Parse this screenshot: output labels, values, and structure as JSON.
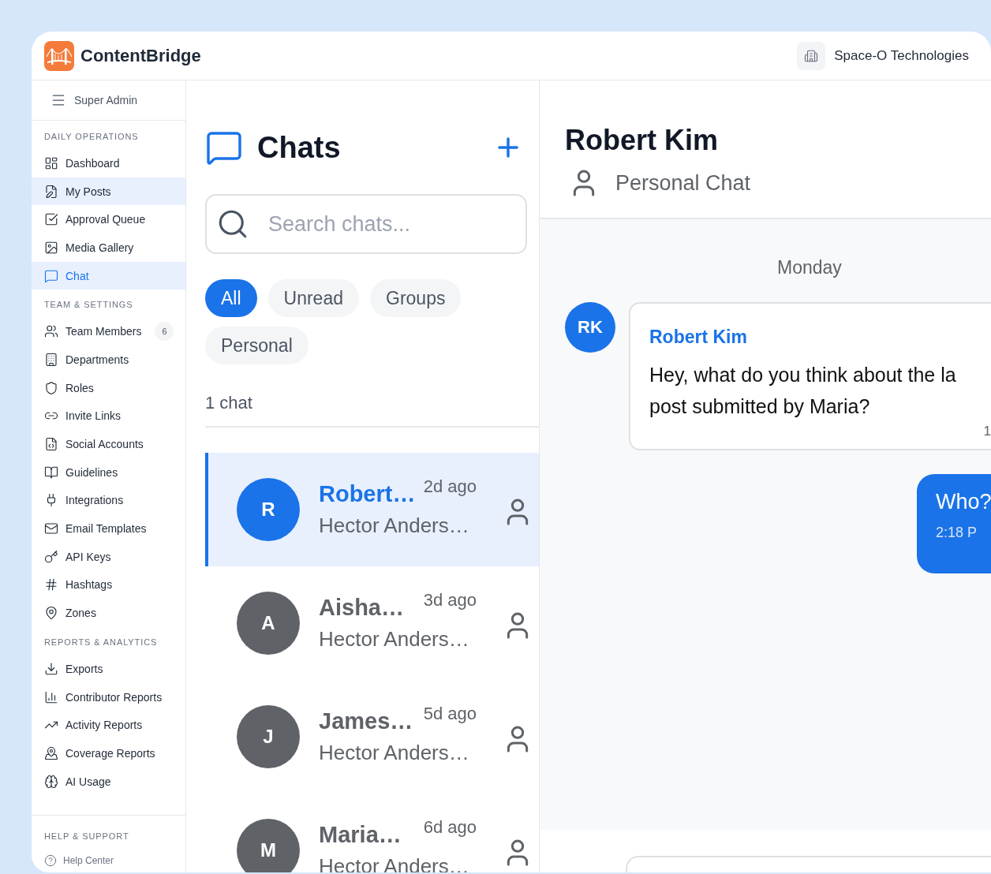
{
  "header": {
    "app_name": "ContentBridge",
    "organization": "Space-O Technologies"
  },
  "sidebar": {
    "role": "Super Admin",
    "sections": [
      {
        "title": "DAILY OPERATIONS",
        "items": [
          {
            "label": "Dashboard",
            "selected": false,
            "hovered": false
          },
          {
            "label": "My Posts",
            "selected": false,
            "hovered": true
          },
          {
            "label": "Approval Queue",
            "selected": false,
            "hovered": false
          },
          {
            "label": "Media Gallery",
            "selected": false,
            "hovered": false
          },
          {
            "label": "Chat",
            "selected": true,
            "hovered": false
          }
        ]
      },
      {
        "title": "TEAM & SETTINGS",
        "items": [
          {
            "label": "Team Members",
            "selected": false,
            "hovered": false,
            "badge": "6"
          },
          {
            "label": "Departments",
            "selected": false,
            "hovered": false
          },
          {
            "label": "Roles",
            "selected": false,
            "hovered": false
          },
          {
            "label": "Invite Links",
            "selected": false,
            "hovered": false
          },
          {
            "label": "Social Accounts",
            "selected": false,
            "hovered": false
          },
          {
            "label": "Guidelines",
            "selected": false,
            "hovered": false
          },
          {
            "label": "Integrations",
            "selected": false,
            "hovered": false
          },
          {
            "label": "Email Templates",
            "selected": false,
            "hovered": false
          },
          {
            "label": "API Keys",
            "selected": false,
            "hovered": false
          },
          {
            "label": "Hashtags",
            "selected": false,
            "hovered": false
          },
          {
            "label": "Zones",
            "selected": false,
            "hovered": false
          }
        ]
      },
      {
        "title": "REPORTS & ANALYTICS",
        "items": [
          {
            "label": "Exports",
            "selected": false,
            "hovered": false
          },
          {
            "label": "Contributor Reports",
            "selected": false,
            "hovered": false
          },
          {
            "label": "Activity Reports",
            "selected": false,
            "hovered": false
          },
          {
            "label": "Coverage Reports",
            "selected": false,
            "hovered": false
          },
          {
            "label": "AI Usage",
            "selected": false,
            "hovered": false
          }
        ]
      }
    ],
    "footer": {
      "title": "HELP & SUPPORT",
      "items": [
        {
          "label": "Help Center"
        }
      ]
    }
  },
  "chats": {
    "title": "Chats",
    "search": {
      "placeholder": "Search chats..."
    },
    "filters": [
      {
        "label": "All",
        "selected": true
      },
      {
        "label": "Unread",
        "selected": false
      },
      {
        "label": "Groups",
        "selected": false
      },
      {
        "label": "Personal",
        "selected": false
      }
    ],
    "count": "1 chat",
    "conversations": [
      {
        "initial": "R",
        "name": "Robert…",
        "time": "2d ago",
        "preview": "Hector Anders…",
        "selected": true
      },
      {
        "initial": "A",
        "name": "Aisha…",
        "time": "3d ago",
        "preview": "Hector Anders…",
        "selected": false
      },
      {
        "initial": "J",
        "name": "James…",
        "time": "5d ago",
        "preview": "Hector Anders…",
        "selected": false
      },
      {
        "initial": "M",
        "name": "Maria…",
        "time": "6d ago",
        "preview": "Hector Anders…",
        "selected": false
      }
    ]
  },
  "conversation": {
    "title": "Robert Kim",
    "subtitle": "Personal Chat",
    "date": "Monday",
    "messages": [
      {
        "kind": "incoming",
        "avatar": "RK",
        "sender": "Robert Kim",
        "lines": [
          "Hey, what do you think about the la",
          "post submitted by Maria?"
        ],
        "time": "1"
      },
      {
        "kind": "outgoing",
        "lines": [
          "Who?"
        ],
        "time": "2:18 P"
      }
    ]
  }
}
